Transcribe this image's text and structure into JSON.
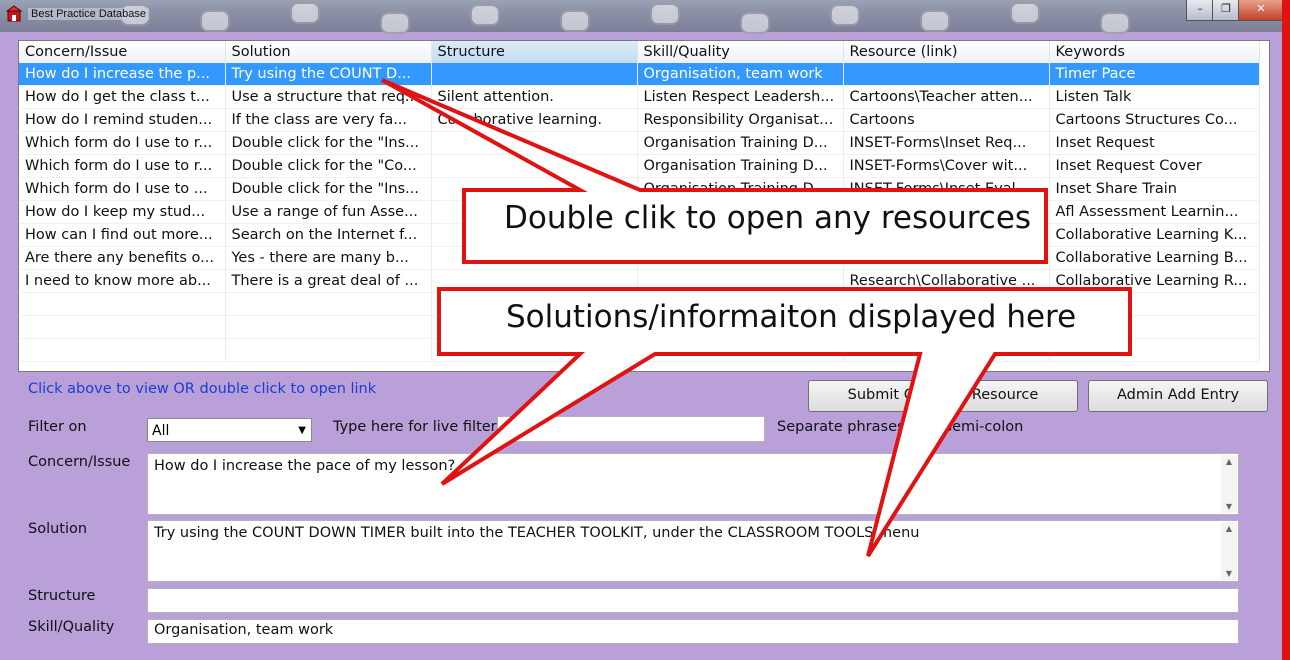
{
  "window": {
    "title": "Best Practice Database",
    "buttons": [
      "–",
      "❐",
      "✕"
    ]
  },
  "grid": {
    "columns": [
      "Concern/Issue",
      "Solution",
      "Structure",
      "Skill/Quality",
      "Resource (link)",
      "Keywords"
    ],
    "rows": [
      [
        "How do I increase the p...",
        "Try using the COUNT D...",
        "",
        "Organisation, team work",
        "",
        "Timer Pace"
      ],
      [
        "How do I get the class t...",
        "Use a structure that req...",
        "Silent attention.",
        "Listen Respect Leadersh...",
        "Cartoons\\Teacher atten...",
        "Listen Talk"
      ],
      [
        "How do I remind studen...",
        "If the class are very fa...",
        "Collaborative learning.",
        "Responsibility Organisati...",
        "Cartoons",
        "Cartoons Structures Co..."
      ],
      [
        "Which form do I use to r...",
        "Double click for the \"Ins...",
        "",
        "Organisation Training D...",
        "INSET-Forms\\Inset Req...",
        "Inset Request"
      ],
      [
        "Which form do I use to r...",
        "Double click for the \"Co...",
        "",
        "Organisation Training D...",
        "INSET-Forms\\Cover wit...",
        "Inset Request Cover"
      ],
      [
        "Which form do I use to ...",
        "Double click for the \"Ins...",
        "",
        "Organisation Training D...",
        "INSET-Forms\\Inset Eval...",
        "Inset Share Train"
      ],
      [
        "How do I keep my stud...",
        "Use a range of fun Asse...",
        "",
        "",
        "",
        "Afl Assessment Learnin..."
      ],
      [
        "How can I find out more...",
        "Search on the Internet f...",
        "",
        "",
        "",
        "Collaborative Learning K..."
      ],
      [
        "Are there any benefits o...",
        "Yes - there are many b...",
        "",
        "",
        "",
        "Collaborative Learning B..."
      ],
      [
        "I need to know more ab...",
        "There is a great deal of ...",
        "",
        "",
        "Research\\Collaborative ...",
        "Collaborative Learning R..."
      ]
    ]
  },
  "form": {
    "hint": "Click above to view OR double click to open link",
    "submit_button": "Submit Query or Resource",
    "admin_button": "Admin Add Entry",
    "filter_label": "Filter on",
    "filter_value": "All",
    "live_filter_label": "Type here for live filter",
    "live_filter_value": "",
    "separate_note": "Separate phrases with semi-colon",
    "concern_label": "Concern/Issue",
    "concern_value": "How do I increase the pace of my lesson?",
    "solution_label": "Solution",
    "solution_value": "Try using the COUNT DOWN TIMER built into the TEACHER TOOLKIT, under the CLASSROOM TOOLS menu",
    "structure_label": "Structure",
    "structure_value": "",
    "skill_label": "Skill/Quality",
    "skill_value": "Organisation, team work"
  },
  "callouts": {
    "top": "Double clik to open any resources",
    "bottom": "Solutions/informaiton displayed here"
  },
  "colors": {
    "background": "#b9a0d8",
    "selection": "#3399ff",
    "callout_border": "#e01212",
    "hint_text": "#1a3fd0"
  }
}
